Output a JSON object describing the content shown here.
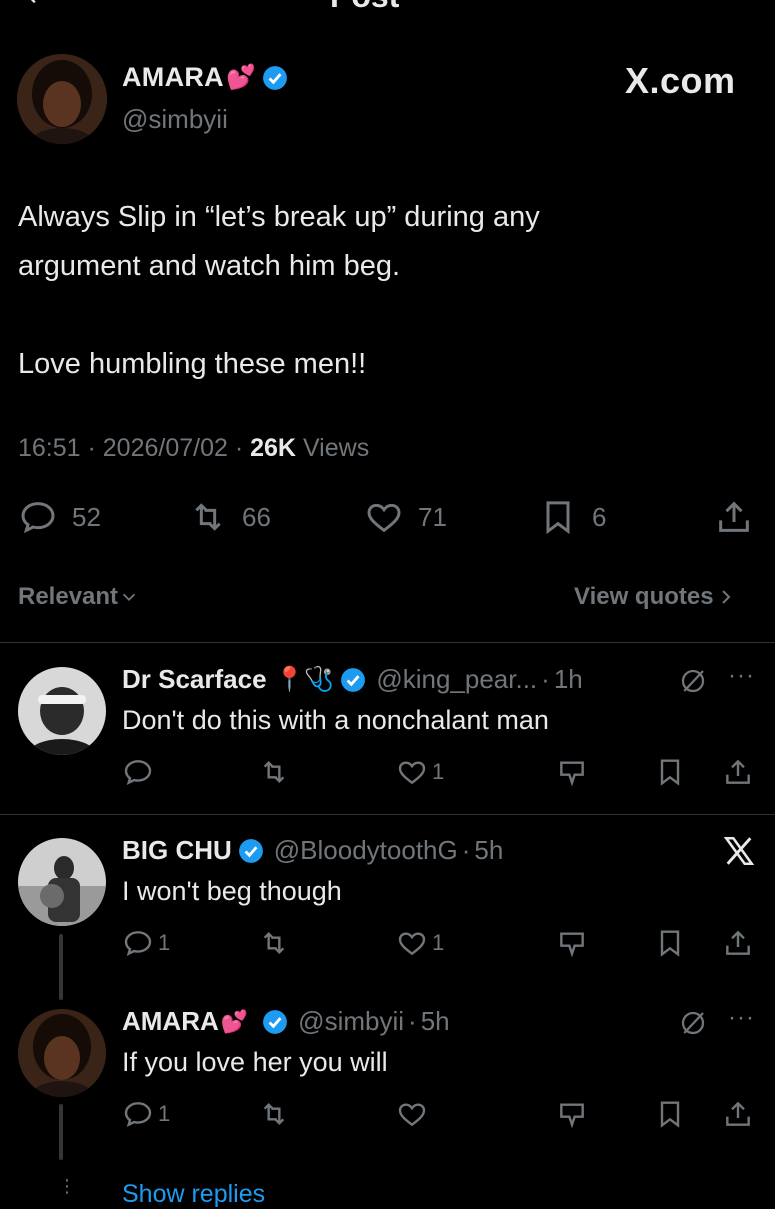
{
  "header": {
    "title": "Post"
  },
  "post": {
    "author_name": "AMARA",
    "author_emoji": "💕",
    "handle": "@simbyii",
    "watermark": "X.com",
    "lines": [
      "Always Slip in “let’s break up” during any",
      "argument and watch him beg.",
      "Love humbling these men!!"
    ],
    "time": "16:51",
    "date": "2026/07/02",
    "views_count": "26K",
    "views_label": "Views",
    "stats": {
      "replies": "52",
      "reposts": "66",
      "likes": "71",
      "bookmarks": "6"
    }
  },
  "sort": {
    "label": "Relevant",
    "quotes_label": "View quotes"
  },
  "replies": [
    {
      "name": "Dr Scarface",
      "emoji": "📍🩺",
      "handle": "@king_pear...",
      "time": "1h",
      "text": "Don't do this with a nonchalant man",
      "replies": "",
      "likes": "1"
    },
    {
      "name": "BIG CHU",
      "handle": "@BloodytoothG",
      "time": "5h",
      "text": "I won't beg though",
      "replies": "1",
      "likes": "1"
    },
    {
      "name": "AMARA",
      "emoji": "💕",
      "handle": "@simbyii",
      "time": "5h",
      "text": "If you love her you will",
      "replies": "1",
      "likes": ""
    }
  ],
  "show_replies": "Show replies",
  "colors": {
    "accent": "#1d9bf0",
    "muted": "#71767b",
    "text": "#e7e9ea",
    "background": "#000000"
  }
}
